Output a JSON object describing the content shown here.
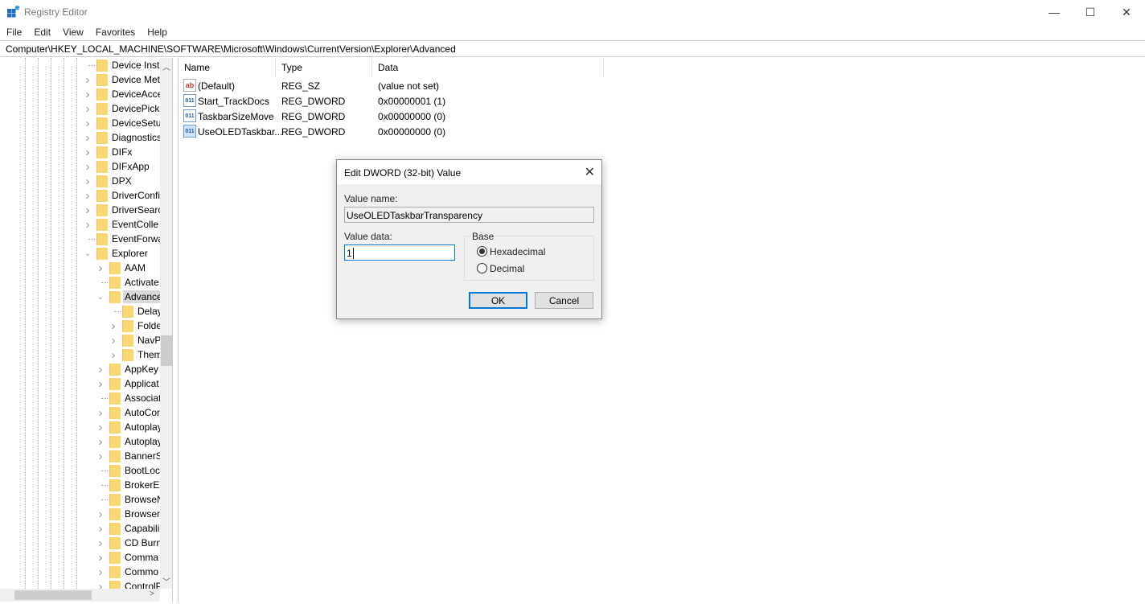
{
  "window": {
    "title": "Registry Editor",
    "minimize": "—",
    "maximize": "☐",
    "close": "✕"
  },
  "menu": [
    "File",
    "Edit",
    "View",
    "Favorites",
    "Help"
  ],
  "address": "Computer\\HKEY_LOCAL_MACHINE\\SOFTWARE\\Microsoft\\Windows\\CurrentVersion\\Explorer\\Advanced",
  "tree": [
    {
      "label": "Device Insta",
      "level": 0,
      "exp": "none"
    },
    {
      "label": "Device Met",
      "level": 0,
      "exp": "collapsed"
    },
    {
      "label": "DeviceAcce",
      "level": 0,
      "exp": "collapsed"
    },
    {
      "label": "DevicePick",
      "level": 0,
      "exp": "collapsed"
    },
    {
      "label": "DeviceSetu",
      "level": 0,
      "exp": "collapsed"
    },
    {
      "label": "Diagnostics",
      "level": 0,
      "exp": "collapsed"
    },
    {
      "label": "DIFx",
      "level": 0,
      "exp": "collapsed"
    },
    {
      "label": "DIFxApp",
      "level": 0,
      "exp": "collapsed"
    },
    {
      "label": "DPX",
      "level": 0,
      "exp": "collapsed"
    },
    {
      "label": "DriverConfi",
      "level": 0,
      "exp": "collapsed"
    },
    {
      "label": "DriverSearc",
      "level": 0,
      "exp": "collapsed"
    },
    {
      "label": "EventColle",
      "level": 0,
      "exp": "collapsed"
    },
    {
      "label": "EventForwa",
      "level": 0,
      "exp": "none"
    },
    {
      "label": "Explorer",
      "level": 0,
      "exp": "expanded"
    },
    {
      "label": "AAM",
      "level": 1,
      "exp": "collapsed"
    },
    {
      "label": "Activate",
      "level": 1,
      "exp": "none"
    },
    {
      "label": "Advance",
      "level": 1,
      "exp": "expanded",
      "selected": true
    },
    {
      "label": "Delay",
      "level": 2,
      "exp": "none"
    },
    {
      "label": "Folde",
      "level": 2,
      "exp": "collapsed"
    },
    {
      "label": "NavP",
      "level": 2,
      "exp": "collapsed"
    },
    {
      "label": "Them",
      "level": 2,
      "exp": "collapsed"
    },
    {
      "label": "AppKey",
      "level": 1,
      "exp": "collapsed"
    },
    {
      "label": "Applicat",
      "level": 1,
      "exp": "collapsed"
    },
    {
      "label": "Associat",
      "level": 1,
      "exp": "none"
    },
    {
      "label": "AutoCor",
      "level": 1,
      "exp": "collapsed"
    },
    {
      "label": "Autoplay",
      "level": 1,
      "exp": "collapsed"
    },
    {
      "label": "Autoplay",
      "level": 1,
      "exp": "collapsed"
    },
    {
      "label": "BannerS",
      "level": 1,
      "exp": "collapsed"
    },
    {
      "label": "BootLoc",
      "level": 1,
      "exp": "none"
    },
    {
      "label": "BrokerEx",
      "level": 1,
      "exp": "none"
    },
    {
      "label": "BrowseN",
      "level": 1,
      "exp": "none"
    },
    {
      "label": "Browser",
      "level": 1,
      "exp": "collapsed"
    },
    {
      "label": "Capabili",
      "level": 1,
      "exp": "collapsed"
    },
    {
      "label": "CD Burn",
      "level": 1,
      "exp": "collapsed"
    },
    {
      "label": "Comma",
      "level": 1,
      "exp": "collapsed"
    },
    {
      "label": "Commo",
      "level": 1,
      "exp": "collapsed"
    },
    {
      "label": "ControlP",
      "level": 1,
      "exp": "collapsed"
    }
  ],
  "list": {
    "columns": [
      "Name",
      "Type",
      "Data"
    ],
    "rows": [
      {
        "icon": "string-value-icon",
        "name": "(Default)",
        "type": "REG_SZ",
        "data": "(value not set)"
      },
      {
        "icon": "binary-value-icon",
        "name": "Start_TrackDocs",
        "type": "REG_DWORD",
        "data": "0x00000001 (1)"
      },
      {
        "icon": "binary-value-icon",
        "name": "TaskbarSizeMove",
        "type": "REG_DWORD",
        "data": "0x00000000 (0)"
      },
      {
        "icon": "binary-value-icon",
        "name": "UseOLEDTaskbar...",
        "type": "REG_DWORD",
        "data": "0x00000000 (0)"
      }
    ]
  },
  "dialog": {
    "title": "Edit DWORD (32-bit) Value",
    "value_name_label": "Value name:",
    "value_name": "UseOLEDTaskbarTransparency",
    "value_data_label": "Value data:",
    "value_data": "1",
    "base_label": "Base",
    "hex_label": "Hexadecimal",
    "dec_label": "Decimal",
    "selected_base": "Hexadecimal",
    "ok": "OK",
    "cancel": "Cancel"
  }
}
